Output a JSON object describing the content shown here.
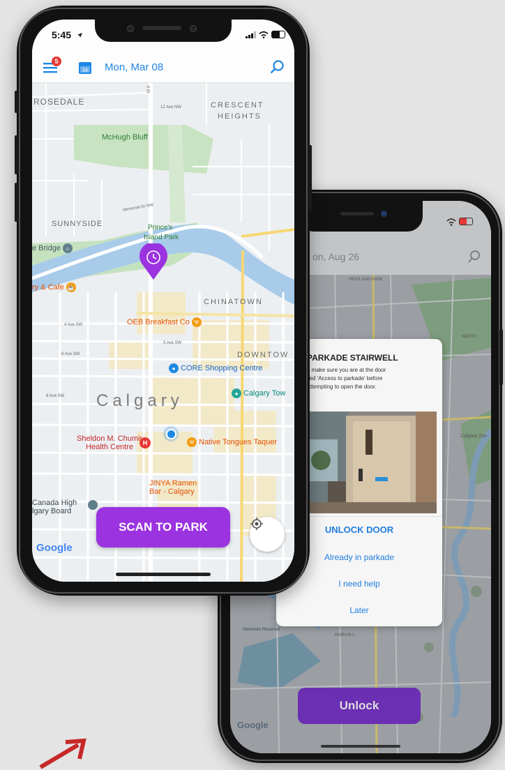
{
  "phone1": {
    "status": {
      "time": "5:45",
      "location_arrow": "location-arrow-icon",
      "signal": "signal-bars-icon",
      "wifi": "wifi-icon",
      "battery": "battery-icon"
    },
    "header": {
      "notification_count": "5",
      "date": "Mon, Mar 08",
      "menu_icon": "hamburger-menu-icon",
      "calendar_icon": "calendar-icon",
      "search_icon": "search-icon",
      "accent": "#1e88e5"
    },
    "map": {
      "neighbourhoods": {
        "rosedale": "ROSEDALE",
        "crescent": "CRESCENT",
        "heights": "HEIGHTS",
        "sunnyside": "SUNNYSIDE",
        "chinatown": "CHINATOWN",
        "downtown": "DOWNTOW",
        "city": "Calgary"
      },
      "parks": {
        "mchugh": "McHugh Bluff",
        "princes1": "Prince's",
        "princes2": "Island Park"
      },
      "streets": {
        "ave12": "12 Ave NW",
        "memorial": "Memorial Dr NW",
        "ave4": "4 Ave SW",
        "ave5": "5 Ave SW",
        "ave6": "6 Ave SW",
        "ave8": "8 Ave SW",
        "st4": "4 St"
      },
      "pois": {
        "bridge": "e Bridge",
        "cafe": "ry & Cafe",
        "oeb": "OEB Breakfast Co",
        "core": "CORE Shopping Centre",
        "tower": "Calgary Tow",
        "sheldon1": "Sheldon M. Chumir",
        "sheldon2": "Health Centre",
        "native": "Native Tongues Taquer",
        "jinya1": "JINYA Ramen",
        "jinya2": "Bar - Calgary",
        "canada1": "Canada High",
        "canada2": "lgary Board"
      },
      "google": "Google"
    },
    "scan_button": "SCAN TO PARK",
    "location_button_icon": "my-location-icon",
    "pin_icon": "parking-pin-icon",
    "brand_purple": "#9b33e0"
  },
  "phone2": {
    "header": {
      "date": "on, Aug 26",
      "search_icon": "search-icon"
    },
    "map_labels": {
      "highland": "HIGHLAND PARK",
      "north": "NORTH",
      "calgary_zoo": "Calgary Zoo",
      "reservoir": "Glenmore Reservoir",
      "bridgeland": "",
      "parkhill": "PARKHILL",
      "google": "Google"
    },
    "modal": {
      "title": "PARKADE STAIRWELL",
      "line1": "e make sure you are at the door",
      "line2": "lled 'Access to parkade' before",
      "line3": "attempting to open the door.",
      "image_alt": "parkade-door-photo",
      "actions": [
        "UNLOCK DOOR",
        "Already in parkade",
        "I need help",
        "Later"
      ]
    },
    "unlock_button": "Unlock",
    "brand_purple_dark": "#6b2fb3"
  }
}
